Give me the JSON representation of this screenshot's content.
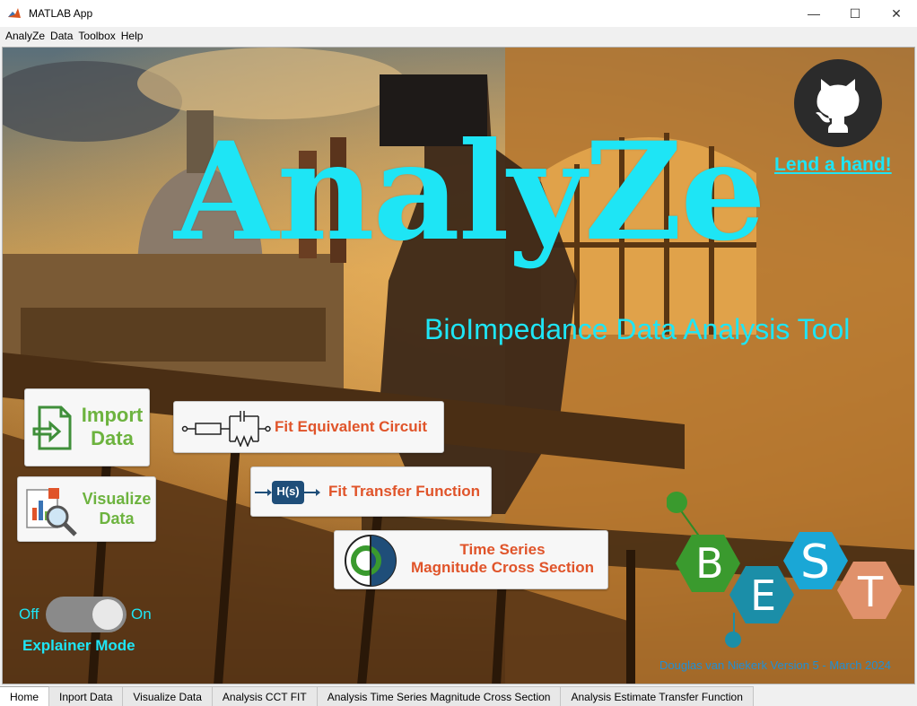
{
  "window": {
    "title": "MATLAB App",
    "minimize_glyph": "—",
    "maximize_glyph": "☐",
    "close_glyph": "✕"
  },
  "menubar": {
    "items": [
      {
        "label": "AnalyZe"
      },
      {
        "label": "Data"
      },
      {
        "label": "Toolbox"
      },
      {
        "label": "Help"
      }
    ]
  },
  "home": {
    "title": "AnalyZe",
    "subtitle": "BioImpedance Data Analysis Tool",
    "lend_hand": "Lend a hand!",
    "github_icon": "github-icon",
    "buttons": {
      "import": {
        "line1": "Import",
        "line2": "Data",
        "icon": "import-file-icon"
      },
      "visualize": {
        "line1": "Visualize",
        "line2": "Data",
        "icon": "magnifier-chart-icon"
      },
      "fit_cct": {
        "label": "Fit Equivalent Circuit",
        "icon": "circuit-icon"
      },
      "fit_tf": {
        "label": "Fit Transfer Function",
        "icon_text": "H(s)",
        "icon": "transfer-function-icon"
      },
      "time_series": {
        "line1": "Time Series",
        "line2": "Magnitude Cross Section",
        "icon": "cross-section-icon"
      }
    },
    "toggle": {
      "off_label": "Off",
      "on_label": "On",
      "state": "on",
      "caption": "Explainer Mode"
    },
    "logo": {
      "letters": [
        "B",
        "E",
        "S",
        "T"
      ],
      "colors": [
        "#3a9a2e",
        "#1b8ea8",
        "#1aa7d6",
        "#e0916b"
      ]
    },
    "version": "Douglas van Niekerk Version 5 - March 2024"
  },
  "tabs": [
    {
      "label": "Home",
      "active": true
    },
    {
      "label": "Inport Data",
      "active": false
    },
    {
      "label": "Visualize Data",
      "active": false
    },
    {
      "label": "Analysis CCT FIT",
      "active": false
    },
    {
      "label": "Analysis Time Series Magnitude Cross Section",
      "active": false
    },
    {
      "label": "Analysis Estimate Transfer Function",
      "active": false
    }
  ],
  "colors": {
    "accent_cyan": "#1ee5f5",
    "button_green": "#6db33f",
    "button_orange": "#e0542a",
    "version_blue": "#1f8fd6"
  }
}
